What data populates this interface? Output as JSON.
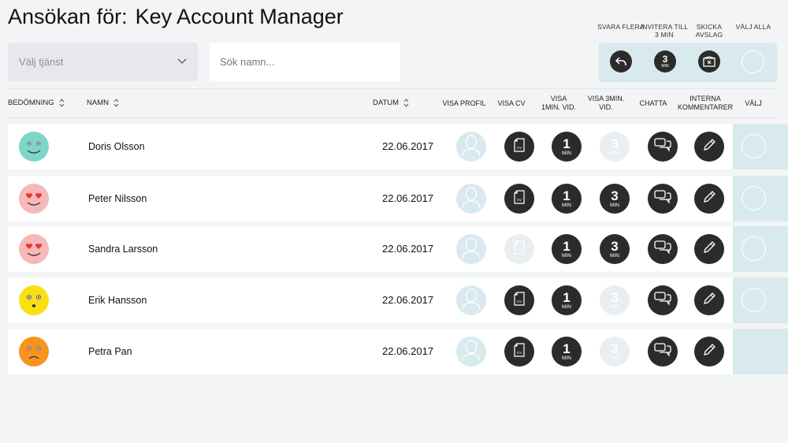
{
  "page": {
    "title_prefix": "Ansökan för:",
    "title_job": "Key Account Manager"
  },
  "filters": {
    "service_select": "Välj tjänst",
    "search_placeholder": "Sök namn..."
  },
  "bulk_actions": [
    {
      "id": "reply",
      "label": "SVARA FLERA",
      "icon": "reply-icon"
    },
    {
      "id": "invite",
      "label": "INVITERA TILL 3 MIN",
      "icon": "video-3min-icon",
      "num": "3",
      "unit": "MIN"
    },
    {
      "id": "reject",
      "label": "SKICKA AVSLAG",
      "icon": "reject-mail-icon"
    },
    {
      "id": "select_all",
      "label": "VÄLJ ALLA",
      "icon": "select-circle-icon"
    }
  ],
  "columns": {
    "rating": "BEDÖMNING",
    "name": "NAMN",
    "date": "DATUM",
    "profile": "VISA PROFIL",
    "cv": "VISA CV",
    "vid1": "VISA 1MIN. VID.",
    "vid3": "VISA 3MIN. VID.",
    "chat": "CHATTA",
    "comments": "INTERNA KOMMENTARER",
    "select": "VÄLJ"
  },
  "video_units": {
    "one": "1",
    "three": "3",
    "unit": "MIN"
  },
  "applicants": [
    {
      "name": "Doris Olsson",
      "date": "22.06.2017",
      "rating": "happy",
      "rating_color": "#7fd6c8",
      "has_cv": true,
      "has_vid1": true,
      "has_vid3": false,
      "selectable": true
    },
    {
      "name": "Peter Nilsson",
      "date": "22.06.2017",
      "rating": "love",
      "rating_color": "#f6b8b8",
      "has_cv": true,
      "has_vid1": true,
      "has_vid3": true,
      "selectable": true
    },
    {
      "name": "Sandra Larsson",
      "date": "22.06.2017",
      "rating": "love",
      "rating_color": "#f6b8b8",
      "has_cv": false,
      "has_vid1": true,
      "has_vid3": true,
      "selectable": true
    },
    {
      "name": "Erik Hansson",
      "date": "22.06.2017",
      "rating": "surprised",
      "rating_color": "#f8e014",
      "has_cv": true,
      "has_vid1": true,
      "has_vid3": false,
      "selectable": true
    },
    {
      "name": "Petra Pan",
      "date": "22.06.2017",
      "rating": "sad",
      "rating_color": "#f7931e",
      "has_cv": true,
      "has_vid1": true,
      "has_vid3": false,
      "selectable": false
    }
  ],
  "colors": {
    "accent_panel": "#d8eaee",
    "dark_icon": "#2b2b2b",
    "faint_icon": "#e9eef1"
  }
}
